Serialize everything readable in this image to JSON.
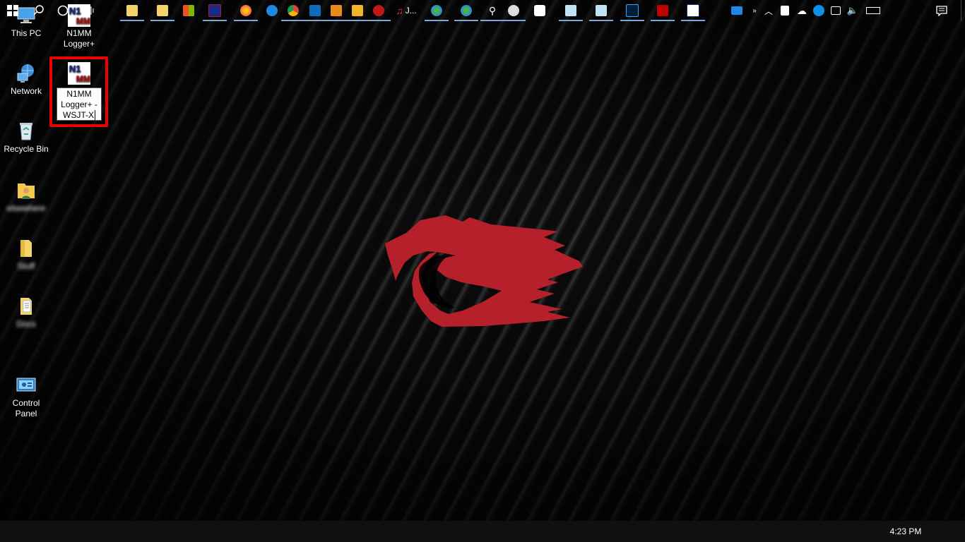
{
  "desktop_icons": [
    {
      "label": "This PC"
    },
    {
      "label": "Network"
    },
    {
      "label": "Recycle Bin"
    },
    {
      "label": "elsewhere"
    },
    {
      "label": "Stuff"
    },
    {
      "label": "Docs"
    },
    {
      "label": "Control\nPanel"
    }
  ],
  "n1mm_icon": {
    "label_line1": "N1MM",
    "label_line2": "Logger+"
  },
  "renaming_icon": {
    "rename_text_line1": "N1MM",
    "rename_text_line2": "Logger+ -",
    "rename_text_line3": "WSJT-X"
  },
  "taskbar": {
    "clock": "4:23 PM",
    "music_app_label": "J..."
  },
  "colors": {
    "selection": "#e00000",
    "logo": "#b5202a",
    "taskbar": "#101010"
  }
}
